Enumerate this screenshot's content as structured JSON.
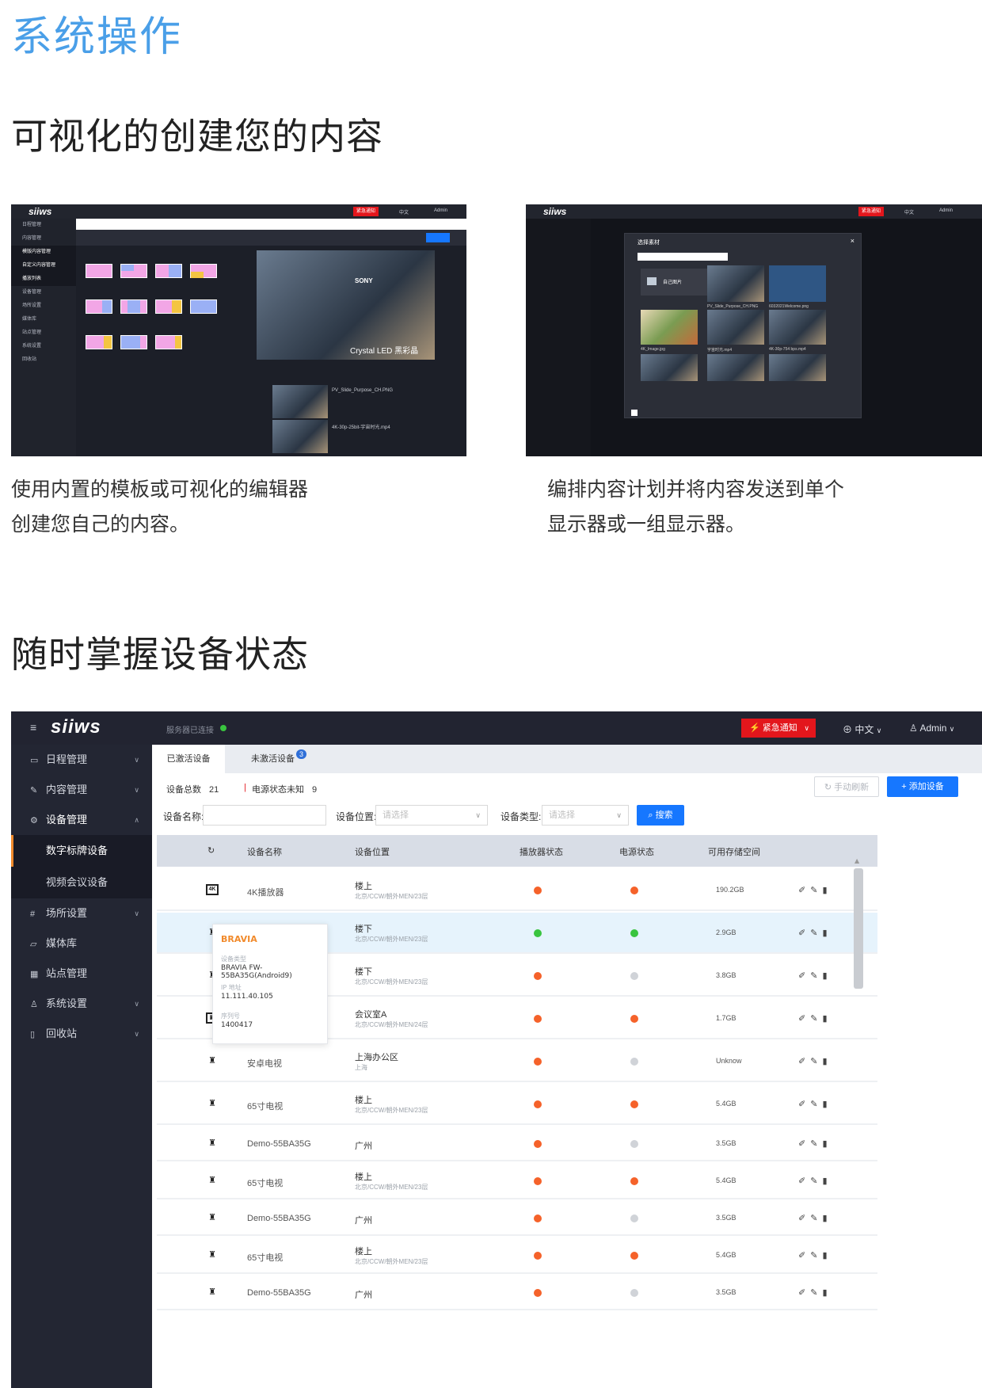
{
  "page": {
    "brand_title": "系统操作",
    "section1_title": "可视化的创建您的内容",
    "caption_left_1": "使用内置的模板或可视化的编辑器",
    "caption_left_2": "创建您自己的内容。",
    "caption_right_1": "编排内容计划并将内容发送到单个",
    "caption_right_2": "显示器或一组显示器。",
    "section2_title": "随时掌握设备状态"
  },
  "shot_left": {
    "logo": "siiws",
    "emergency": "紧急通知",
    "lang": "中文",
    "user": "Admin",
    "menu": [
      "日程管理",
      "内容管理",
      "模版内容管理",
      "自定义内容管理",
      "播放列表",
      "设备管理",
      "场所设置",
      "媒体库",
      "站点管理",
      "系统设置",
      "回收站"
    ],
    "photo_caption_1": "SONY",
    "photo_caption_2": "Crystal LED 黑彩晶",
    "file_1": "PV_Slide_Purpose_CH.PNG",
    "file_2": "4K-30p-25bit-宇宙时光.mp4"
  },
  "shot_right": {
    "logo": "siiws",
    "emergency": "紧急通知",
    "lang": "中文",
    "user": "Admin",
    "dialog_title": "选择素材",
    "folder": "自己图片",
    "file_a": "PV_Slide_Purpose_CH.PNG",
    "file_b": "6032021Welcome.png",
    "file_c": "4K_Image.jpg",
    "file_d": "宇宙时光.mp4",
    "file_e": "4K-30p-754 bps.mp4"
  },
  "app": {
    "logo": "siiws",
    "server_status": "服务器已连接",
    "emergency": "紧急通知",
    "lang": "中文",
    "user": "Admin",
    "menu": {
      "schedule": "日程管理",
      "content": "内容管理",
      "device": "设备管理",
      "device_sub_1": "数字标牌设备",
      "device_sub_2": "视频会议设备",
      "venue": "场所设置",
      "media": "媒体库",
      "site": "站点管理",
      "system": "系统设置",
      "recycle": "回收站"
    },
    "tabs": {
      "active": "已激活设备",
      "inactive": "未激活设备",
      "inactive_count": "3"
    },
    "stats": {
      "total_label": "设备总数",
      "total": "21",
      "unknown_label": "电源状态未知",
      "unknown": "9"
    },
    "buttons": {
      "refresh": "手动刷新",
      "add": "添加设备",
      "search": "搜索"
    },
    "filters": {
      "name_label": "设备名称:",
      "location_label": "设备位置:",
      "location_placeholder": "请选择",
      "type_label": "设备类型:",
      "type_placeholder": "请选择"
    },
    "columns": {
      "name": "设备名称",
      "location": "设备位置",
      "player": "播放器状态",
      "power": "电源状态",
      "storage": "可用存储空间"
    },
    "colors": {
      "orange": "#f5622a",
      "green": "#39c43f",
      "gray": "#d0d3d8",
      "accent": "#1677ff",
      "emergency": "#e3161c"
    },
    "rows": [
      {
        "icon": "4k-box-icon",
        "name": "4K播放器",
        "location": "楼上",
        "sub": "北京/CCW/朝外MEN/23层",
        "player": "orange",
        "power": "orange",
        "storage": "190.2GB"
      },
      {
        "icon": "android-icon",
        "name": "",
        "location": "楼下",
        "sub": "北京/CCW/朝外MEN/23层",
        "player": "green",
        "power": "green",
        "storage": "2.9GB"
      },
      {
        "icon": "android-icon",
        "name": "",
        "location": "楼下",
        "sub": "北京/CCW/朝外MEN/23层",
        "player": "orange",
        "power": "gray",
        "storage": "3.8GB"
      },
      {
        "icon": "display-box-icon",
        "name": "",
        "location": "会议室A",
        "sub": "北京/CCW/朝外MEN/24层",
        "player": "orange",
        "power": "orange",
        "storage": "1.7GB"
      },
      {
        "icon": "android-icon",
        "name": "安卓电视",
        "location": "上海办公区",
        "sub": "上海",
        "player": "orange",
        "power": "gray",
        "storage": "Unknow"
      },
      {
        "icon": "android-icon",
        "name": "65寸电视",
        "location": "楼上",
        "sub": "北京/CCW/朝外MEN/23层",
        "player": "orange",
        "power": "orange",
        "storage": "5.4GB"
      },
      {
        "icon": "android-icon",
        "name": "Demo-55BA35G",
        "location": "广州",
        "sub": "",
        "player": "orange",
        "power": "gray",
        "storage": "3.5GB"
      },
      {
        "icon": "android-icon",
        "name": "65寸电视",
        "location": "楼上",
        "sub": "北京/CCW/朝外MEN/23层",
        "player": "orange",
        "power": "orange",
        "storage": "5.4GB"
      },
      {
        "icon": "android-icon",
        "name": "Demo-55BA35G",
        "location": "广州",
        "sub": "",
        "player": "orange",
        "power": "gray",
        "storage": "3.5GB"
      },
      {
        "icon": "android-icon",
        "name": "65寸电视",
        "location": "楼上",
        "sub": "北京/CCW/朝外MEN/23层",
        "player": "orange",
        "power": "orange",
        "storage": "5.4GB"
      },
      {
        "icon": "android-icon",
        "name": "Demo-55BA35G",
        "location": "广州",
        "sub": "",
        "player": "orange",
        "power": "gray",
        "storage": "3.5GB"
      }
    ],
    "popover": {
      "title": "BRAVIA",
      "type_label": "设备类型",
      "type_value": "BRAVIA FW-55BA35G(Android9)",
      "ip_label": "IP 地址",
      "ip_value": "11.111.40.105",
      "serial_label": "序列号",
      "serial_value": "1400417"
    }
  }
}
